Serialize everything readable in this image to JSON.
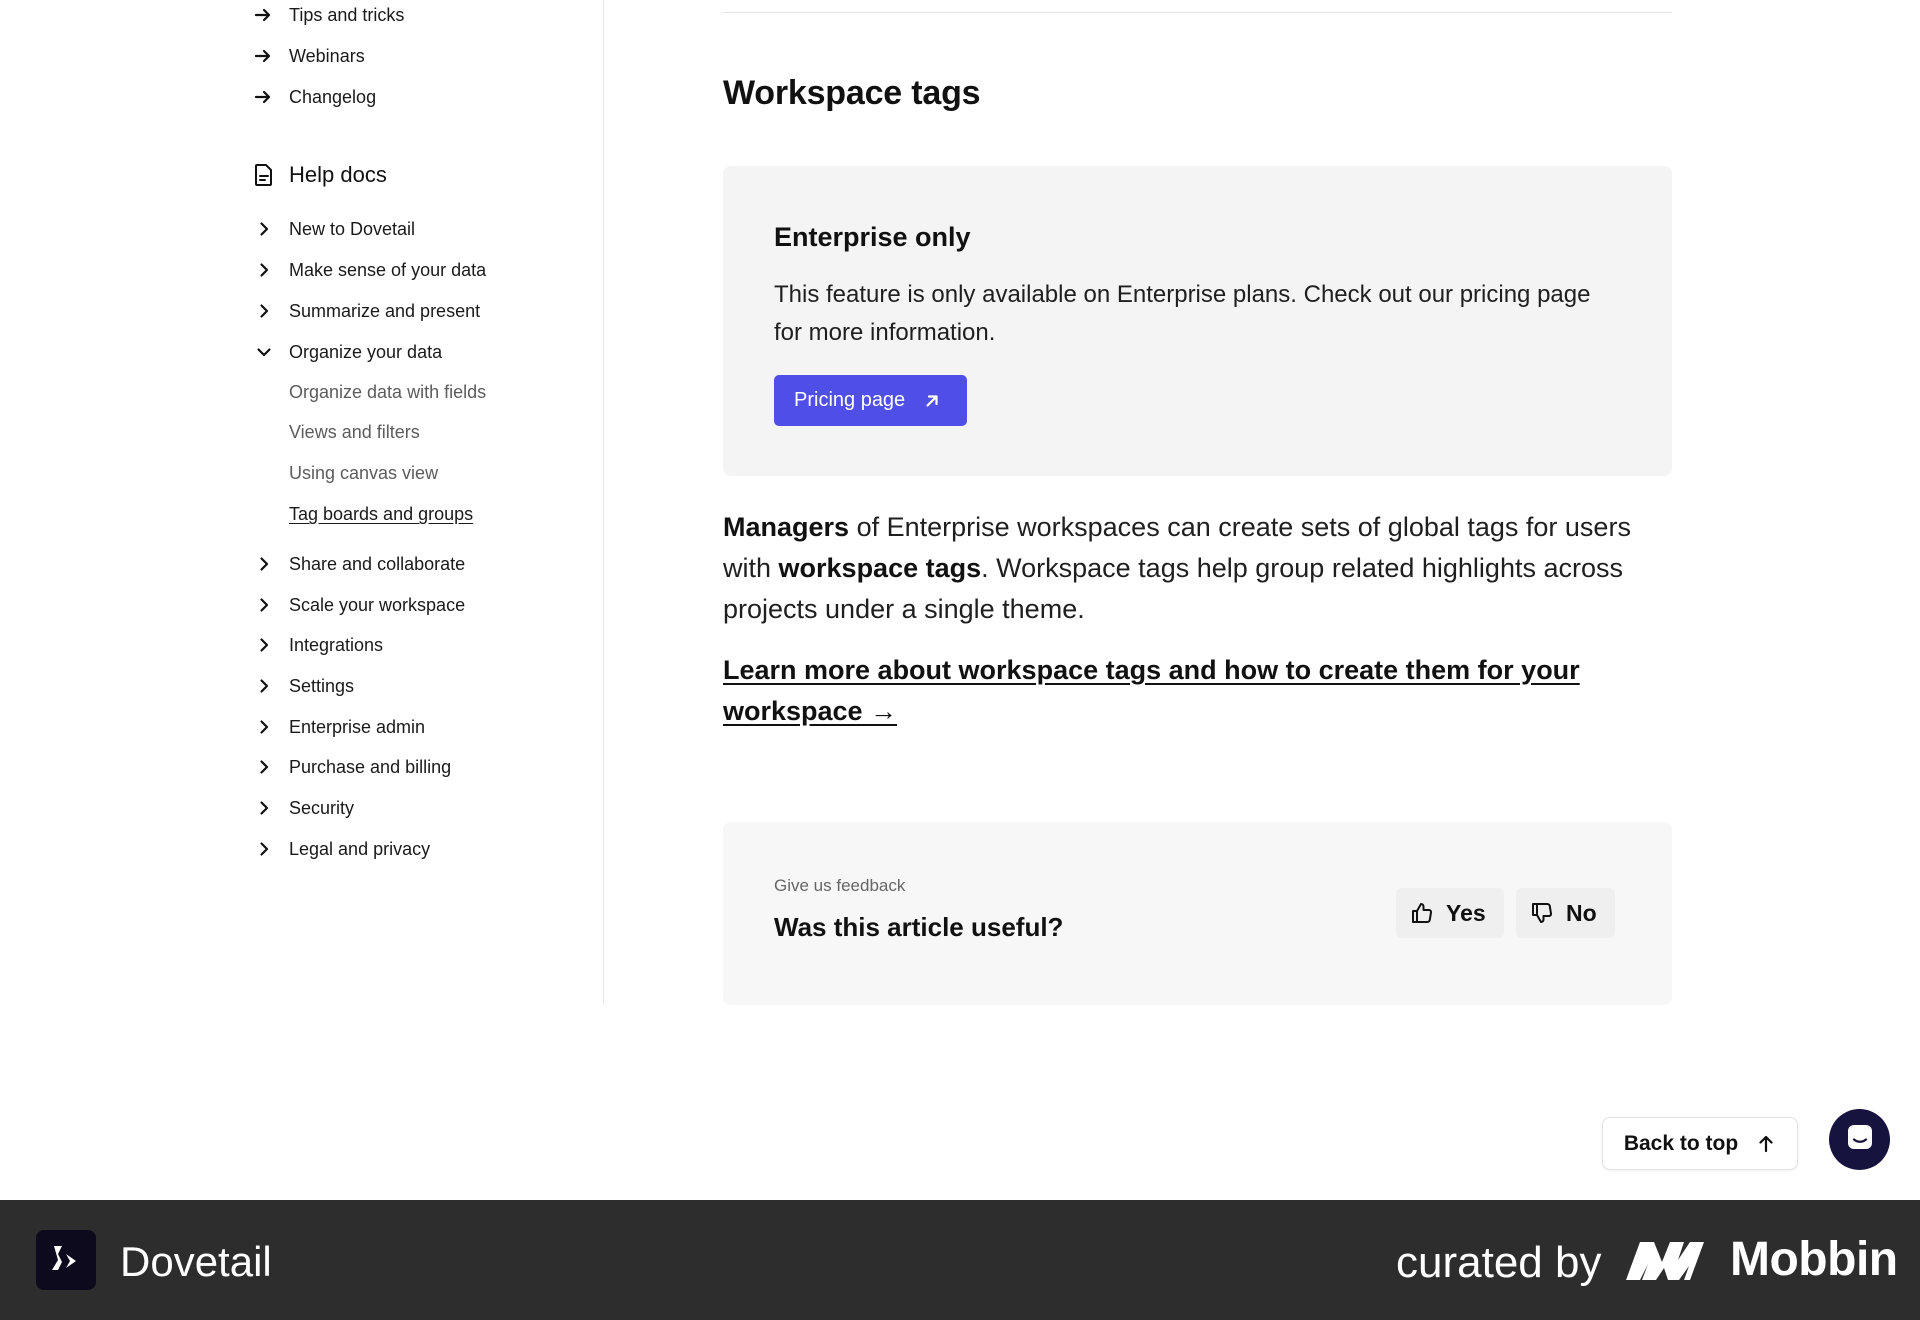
{
  "sidebar": {
    "links": [
      {
        "label": "Tips and tricks"
      },
      {
        "label": "Webinars"
      },
      {
        "label": "Changelog"
      }
    ],
    "help_docs_title": "Help docs",
    "sections": [
      {
        "label": "New to Dovetail"
      },
      {
        "label": "Make sense of your data"
      },
      {
        "label": "Summarize and present"
      },
      {
        "label": "Organize your data"
      },
      {
        "label": "Share and collaborate"
      },
      {
        "label": "Scale your workspace"
      },
      {
        "label": "Integrations"
      },
      {
        "label": "Settings"
      },
      {
        "label": "Enterprise admin"
      },
      {
        "label": "Purchase and billing"
      },
      {
        "label": "Security"
      },
      {
        "label": "Legal and privacy"
      }
    ],
    "subitems": [
      {
        "label": "Organize data with fields"
      },
      {
        "label": "Views and filters"
      },
      {
        "label": "Using canvas view"
      },
      {
        "label": "Tag boards and groups"
      }
    ]
  },
  "main": {
    "title": "Workspace tags",
    "callout": {
      "title": "Enterprise only",
      "text": "This feature is only available on Enterprise plans. Check out our pricing page for more information.",
      "button_label": "Pricing page"
    },
    "paragraph": {
      "bold1": "Managers",
      "text1": " of Enterprise workspaces can create sets of global tags for users with ",
      "bold2": "workspace tags",
      "text2": ". Workspace tags help group related highlights across projects under a single theme."
    },
    "learn_more": "Learn more about workspace tags and how to create them for your workspace →",
    "feedback": {
      "label": "Give us feedback",
      "question": "Was this article useful?",
      "yes": "Yes",
      "no": "No"
    },
    "back_to_top": "Back to top"
  },
  "footer": {
    "brand": "Dovetail",
    "curated_by": "curated by",
    "curator": "Mobbin"
  },
  "colors": {
    "accent": "#4f4fe8",
    "chat_bubble": "#16143f",
    "footer_bg": "#2d2d2e"
  },
  "icons": [
    "arrow-right-icon",
    "document-icon",
    "chevron-right-icon",
    "chevron-down-icon",
    "external-link-icon",
    "thumbs-up-icon",
    "thumbs-down-icon",
    "arrow-up-icon",
    "chat-icon",
    "dovetail-logo-icon",
    "mobbin-logo-icon"
  ]
}
